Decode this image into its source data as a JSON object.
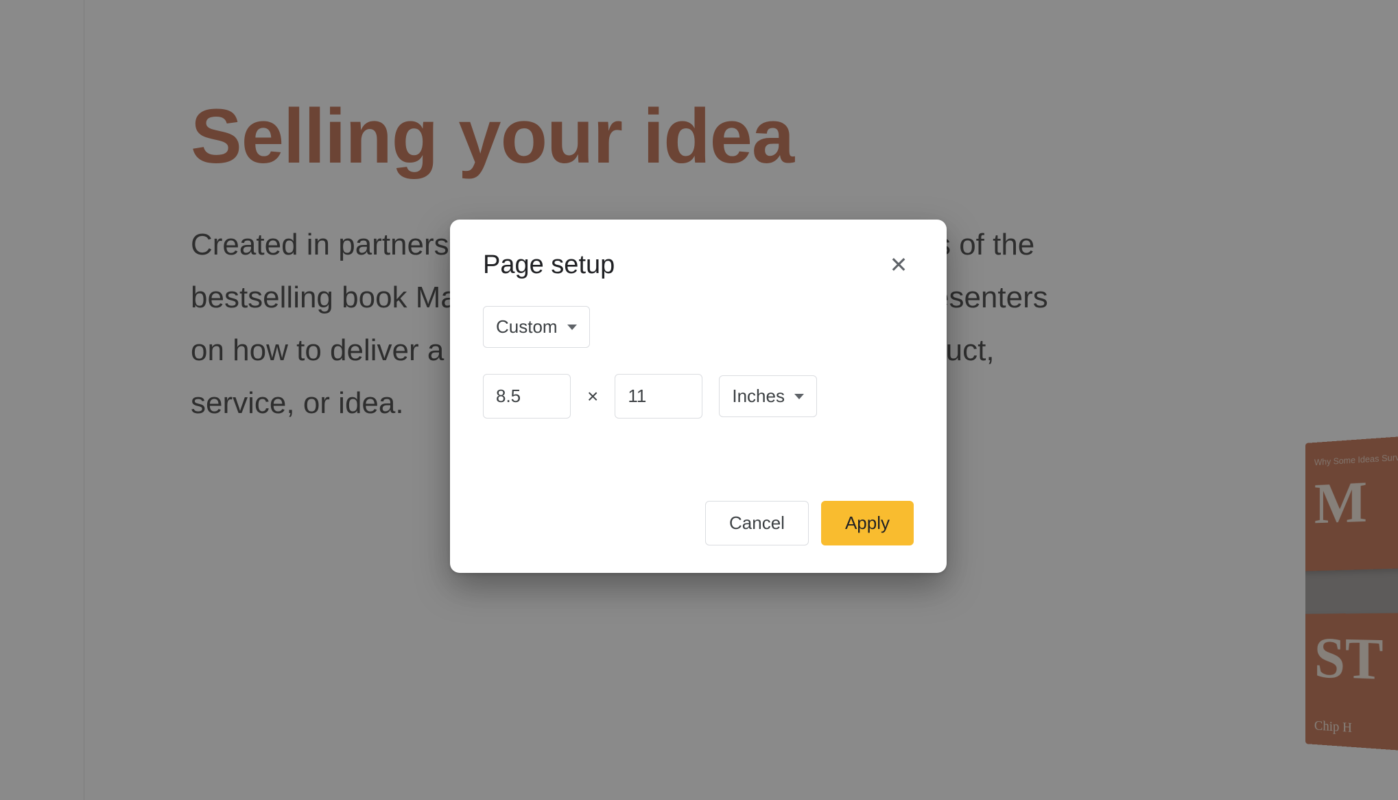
{
  "slide": {
    "title": "Selling your idea",
    "body": "Created in partnership with Chip and Dan Heath, authors of the bestselling book Made to Stick, this template advises presenters on how to deliver a memorable presentation on any product, service, or idea.",
    "book": {
      "tagline": "Why Some Ideas Survive",
      "word1": "M",
      "word2": "ST",
      "authors": "Chip H"
    }
  },
  "dialog": {
    "title": "Page setup",
    "preset_label": "Custom",
    "width_value": "8.5",
    "height_value": "11",
    "units_label": "Inches",
    "separator": "×",
    "cancel_label": "Cancel",
    "apply_label": "Apply",
    "close_glyph": "✕"
  }
}
